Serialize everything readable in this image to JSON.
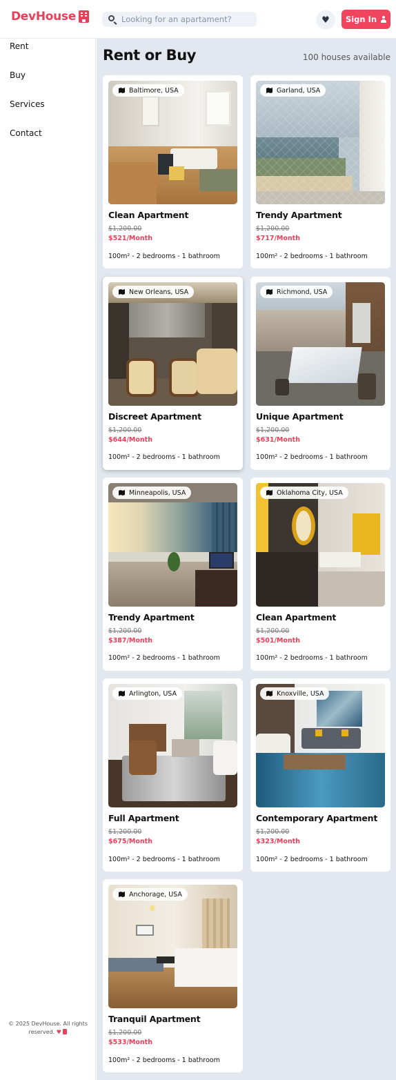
{
  "app": {
    "logo_text": "DevHouse"
  },
  "header": {
    "search_placeholder": "Looking for an apartament?",
    "signin_label": "Sign In"
  },
  "sidebar": {
    "items": [
      {
        "label": "Rent"
      },
      {
        "label": "Buy"
      },
      {
        "label": "Services"
      },
      {
        "label": "Contact"
      }
    ],
    "footer_text": "© 2025 DevHouse. All rights reserved."
  },
  "main": {
    "title": "Rent or Buy",
    "count_text": "100 houses available"
  },
  "colors": {
    "brand": "#e8405a",
    "main_bg": "#e3e8f0",
    "search_bg": "#eef2f7"
  },
  "listings": [
    {
      "location": "Baltimore, USA",
      "title": "Clean Apartment",
      "old_price": "$1,200.00",
      "price": "$521/Month",
      "specs": "100m² - 2 bedrooms - 1 bathroom"
    },
    {
      "location": "Garland, USA",
      "title": "Trendy Apartment",
      "old_price": "$1,200.00",
      "price": "$717/Month",
      "specs": "100m² - 2 bedrooms - 1 bathroom"
    },
    {
      "location": "New Orleans, USA",
      "title": "Discreet Apartment",
      "old_price": "$1,200.00",
      "price": "$644/Month",
      "specs": "100m² - 2 bedrooms - 1 bathroom"
    },
    {
      "location": "Richmond, USA",
      "title": "Unique Apartment",
      "old_price": "$1,200.00",
      "price": "$631/Month",
      "specs": "100m² - 2 bedrooms - 1 bathroom"
    },
    {
      "location": "Minneapolis, USA",
      "title": "Trendy Apartment",
      "old_price": "$1,200.00",
      "price": "$387/Month",
      "specs": "100m² - 2 bedrooms - 1 bathroom"
    },
    {
      "location": "Oklahoma City, USA",
      "title": "Clean Apartment",
      "old_price": "$1,200.00",
      "price": "$501/Month",
      "specs": "100m² - 2 bedrooms - 1 bathroom"
    },
    {
      "location": "Arlington, USA",
      "title": "Full Apartment",
      "old_price": "$1,200.00",
      "price": "$675/Month",
      "specs": "100m² - 2 bedrooms - 1 bathroom"
    },
    {
      "location": "Knoxville, USA",
      "title": "Contemporary Apartment",
      "old_price": "$1,200.00",
      "price": "$323/Month",
      "specs": "100m² - 2 bedrooms - 1 bathroom"
    },
    {
      "location": "Anchorage, USA",
      "title": "Tranquil Apartment",
      "old_price": "$1,200.00",
      "price": "$533/Month",
      "specs": "100m² - 2 bedrooms - 1 bathroom"
    }
  ]
}
